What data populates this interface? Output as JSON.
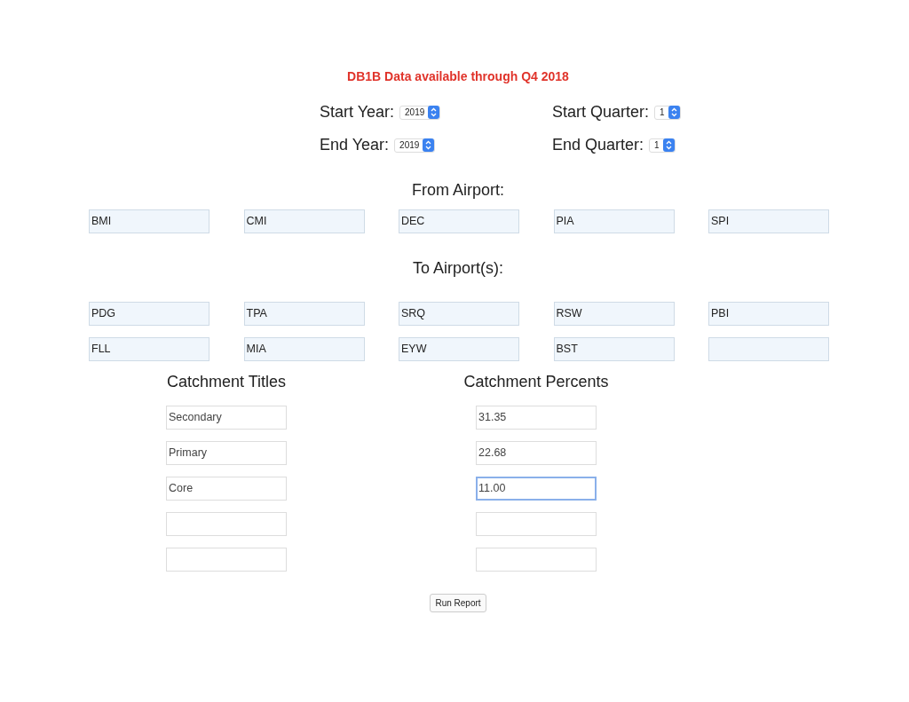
{
  "notice": "DB1B Data available through Q4 2018",
  "date_selects": [
    {
      "label": "Start Year:",
      "value": "2019"
    },
    {
      "label": "Start Quarter:",
      "value": "1"
    },
    {
      "label": "End Year:",
      "value": "2019"
    },
    {
      "label": "End Quarter:",
      "value": "1"
    }
  ],
  "from_airport": {
    "label": "From Airport:",
    "fields": [
      {
        "value": "BMI",
        "focused": false
      },
      {
        "value": "CMI",
        "focused": false
      },
      {
        "value": "DEC",
        "focused": false
      },
      {
        "value": "PIA",
        "focused": false
      },
      {
        "value": "SPI",
        "focused": false
      }
    ]
  },
  "to_airports": {
    "label": "To Airport(s):",
    "fields": [
      {
        "value": "PDG",
        "focused": false
      },
      {
        "value": "TPA",
        "focused": false
      },
      {
        "value": "SRQ",
        "focused": false
      },
      {
        "value": "RSW",
        "focused": false
      },
      {
        "value": "PBI",
        "focused": false
      },
      {
        "value": "FLL",
        "focused": false
      },
      {
        "value": "MIA",
        "focused": false
      },
      {
        "value": "EYW",
        "focused": false
      },
      {
        "value": "BST",
        "focused": false
      },
      {
        "focused": false
      }
    ]
  },
  "catchment_titles": {
    "label": "Catchment Titles",
    "fields": [
      {
        "value": "Secondary",
        "focused": false
      },
      {
        "value": "Primary",
        "focused": false
      },
      {
        "value": "Core",
        "focused": false
      },
      {
        "focused": false
      },
      {
        "focused": false
      }
    ]
  },
  "catchment_percents": {
    "label": "Catchment Percents",
    "fields": [
      {
        "value": "31.35",
        "focused": false
      },
      {
        "value": "22.68",
        "focused": false
      },
      {
        "value": "11.00",
        "focused": true
      },
      {
        "focused": false
      },
      {
        "focused": false
      }
    ]
  },
  "run_button": "Run Report"
}
